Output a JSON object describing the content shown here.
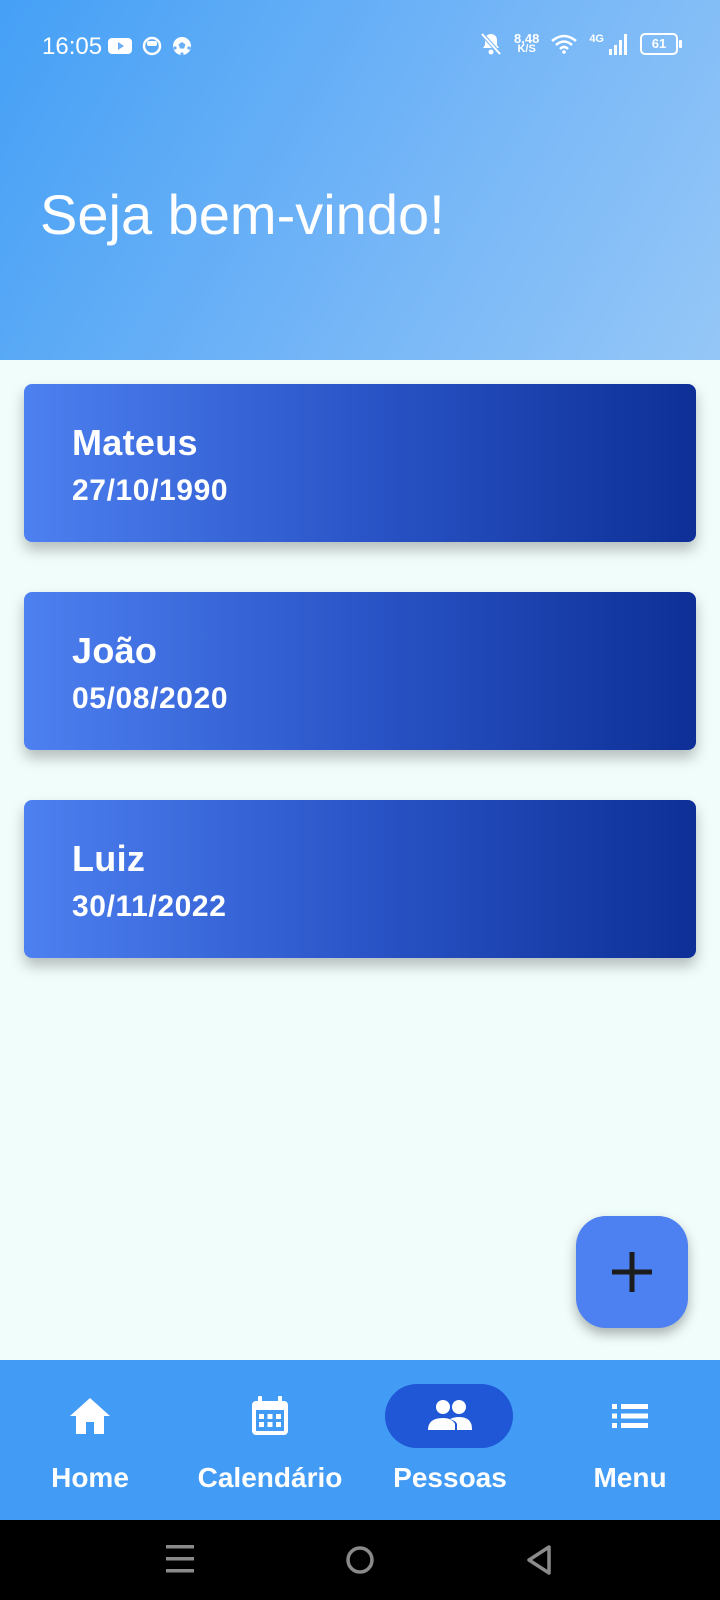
{
  "status_bar": {
    "time": "16:05",
    "net_speed_value": "8,48",
    "net_speed_unit": "K/S",
    "network_type": "4G",
    "battery": "61",
    "left_icons": [
      "youtube-icon",
      "app-icon",
      "soccer-ball-icon"
    ],
    "right_icons": [
      "bell-off-icon",
      "wifi-icon",
      "signal-icon",
      "battery-icon"
    ]
  },
  "header": {
    "title": "Seja bem-vindo!"
  },
  "people": [
    {
      "name": "Mateus",
      "date": "27/10/1990"
    },
    {
      "name": "João",
      "date": "05/08/2020"
    },
    {
      "name": "Luiz",
      "date": "30/11/2022"
    }
  ],
  "fab": {
    "icon": "plus-icon"
  },
  "bottom_nav": {
    "items": [
      {
        "label": "Home",
        "icon": "home-icon"
      },
      {
        "label": "Calendário",
        "icon": "calendar-icon"
      },
      {
        "label": "Pessoas",
        "icon": "people-icon",
        "active": true
      },
      {
        "label": "Menu",
        "icon": "list-icon"
      }
    ]
  },
  "colors": {
    "accent": "#4d80f0",
    "nav_background": "#429bf5",
    "nav_active": "#1f57d6",
    "page_background": "#f0fdfb",
    "card_gradient_end": "#0d2f96"
  }
}
